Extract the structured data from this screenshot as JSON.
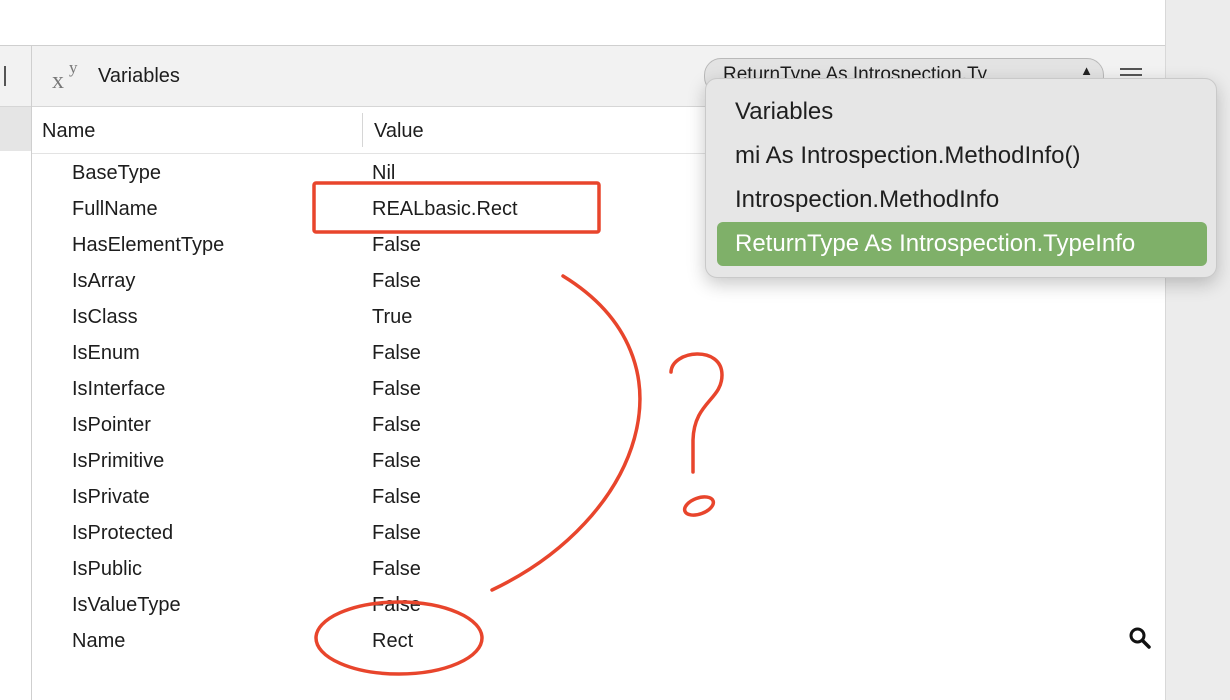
{
  "panel": {
    "icon": "xy-variables-icon",
    "icon_x": "x",
    "icon_y": "y",
    "title": "Variables",
    "scope_popup_value": "ReturnType As Introspection.Ty",
    "scope_arrow": "▲"
  },
  "columns": {
    "name": "Name",
    "value": "Value"
  },
  "rows": [
    {
      "name": "BaseType",
      "value": "Nil"
    },
    {
      "name": "FullName",
      "value": "REALbasic.Rect"
    },
    {
      "name": "HasElementType",
      "value": "False"
    },
    {
      "name": "IsArray",
      "value": "False"
    },
    {
      "name": "IsClass",
      "value": "True"
    },
    {
      "name": "IsEnum",
      "value": "False"
    },
    {
      "name": "IsInterface",
      "value": "False"
    },
    {
      "name": "IsPointer",
      "value": "False"
    },
    {
      "name": "IsPrimitive",
      "value": "False"
    },
    {
      "name": "IsPrivate",
      "value": "False"
    },
    {
      "name": "IsProtected",
      "value": "False"
    },
    {
      "name": "IsPublic",
      "value": "False"
    },
    {
      "name": "IsValueType",
      "value": "False"
    },
    {
      "name": "Name",
      "value": "Rect"
    }
  ],
  "menu": {
    "items": [
      {
        "label": "Variables",
        "selected": false
      },
      {
        "label": "mi As Introspection.MethodInfo()",
        "selected": false
      },
      {
        "label": "Introspection.MethodInfo",
        "selected": false
      },
      {
        "label": "ReturnType As Introspection.TypeInfo",
        "selected": true
      }
    ],
    "selected_color": "#7fb069"
  },
  "annotations": {
    "color": "#e8452c",
    "question_mark": "?"
  },
  "icons": {
    "search": "search-icon",
    "menu": "hamburger-icon"
  }
}
